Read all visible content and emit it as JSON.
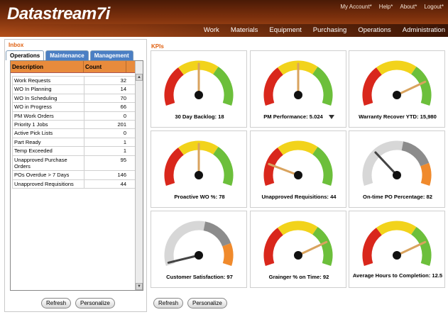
{
  "app": {
    "logo": "Datastream7i",
    "toplinks": [
      "My Account*",
      "Help*",
      "About*",
      "Logout*"
    ],
    "nav": [
      "Work",
      "Materials",
      "Equipment",
      "Purchasing",
      "Operations",
      "Administration"
    ]
  },
  "inbox": {
    "title": "Inbox",
    "tabs": [
      "Operations",
      "Maintenance",
      "Management"
    ],
    "active_tab": "Operations",
    "columns": [
      "Description",
      "Count"
    ],
    "rows": [
      {
        "desc": "Work Requests",
        "count": "32"
      },
      {
        "desc": "WO In Planning",
        "count": "14"
      },
      {
        "desc": "WO In Scheduling",
        "count": "70"
      },
      {
        "desc": "WO in Progress",
        "count": "66"
      },
      {
        "desc": "PM Work Orders",
        "count": "0"
      },
      {
        "desc": "Priority 1 Jobs",
        "count": "201"
      },
      {
        "desc": "Active Pick Lists",
        "count": "0"
      },
      {
        "desc": "Part Ready",
        "count": "1"
      },
      {
        "desc": "Temp Exceeded",
        "count": "1"
      },
      {
        "desc": "Unapproved Purchase Orders",
        "count": "95"
      },
      {
        "desc": "POs Overdue > 7 Days",
        "count": "146"
      },
      {
        "desc": "Unapproved Requisitions",
        "count": "44"
      }
    ],
    "buttons": {
      "refresh": "Refresh",
      "personalize": "Personalize"
    }
  },
  "kpis": {
    "title": "KPIs",
    "buttons": {
      "refresh": "Refresh",
      "personalize": "Personalize"
    },
    "gauges": [
      {
        "label": "30 Day Backlog: 18",
        "style": "rgy",
        "needle": 0.5
      },
      {
        "label": "PM Performance: 5.024",
        "style": "rgy",
        "needle": 0.5,
        "dropdown": true
      },
      {
        "label": "Warranty Recover YTD: 15,980",
        "style": "rgy",
        "needle": 0.8
      },
      {
        "label": "Proactive WO %: 78",
        "style": "rgy",
        "needle": 0.5
      },
      {
        "label": "Unapproved Requisitions: 44",
        "style": "rgy",
        "needle": 0.18
      },
      {
        "label": "On-time PO Percentage: 82",
        "style": "grey",
        "needle": 0.3
      },
      {
        "label": "Customer Satisfaction: 97",
        "style": "grey",
        "needle": 0.02
      },
      {
        "label": "Grainger % on Time: 92",
        "style": "rgy",
        "needle": 0.8
      },
      {
        "label": "Average Hours to Completion: 12.5",
        "style": "rgy",
        "needle": 0.8
      }
    ]
  },
  "colors": {
    "red": "#d9271c",
    "yellow": "#f2d31b",
    "green": "#6cbf3b",
    "grey_light": "#d7d7d7",
    "grey_dark": "#8c8c8c",
    "orange": "#f08a2c",
    "needle": "#d9a35e"
  }
}
